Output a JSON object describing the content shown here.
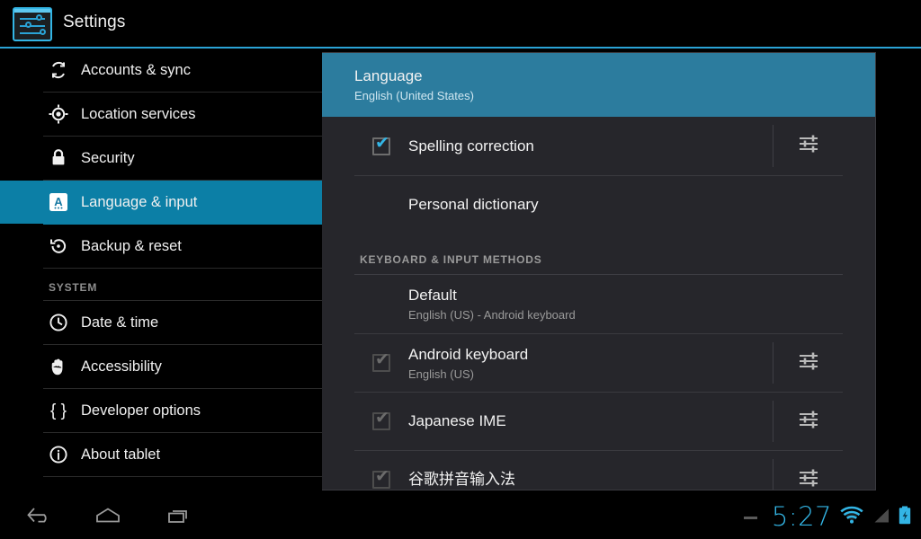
{
  "window": {
    "title": "Settings",
    "app_icon": "settings-sliders-icon"
  },
  "colors": {
    "accent_blue": "#33b5e5",
    "sidebar_selected": "#0c7fa6",
    "row_highlight": "#2c7c9e",
    "panel_bg": "#26262b",
    "sidebar_bg": "#000000"
  },
  "sidebar": {
    "items": [
      {
        "label": "Accounts & sync",
        "icon": "sync-icon",
        "selected": false
      },
      {
        "label": "Location services",
        "icon": "location-icon",
        "selected": false
      },
      {
        "label": "Security",
        "icon": "lock-icon",
        "selected": false
      },
      {
        "label": "Language & input",
        "icon": "language-a-icon",
        "selected": true
      },
      {
        "label": "Backup & reset",
        "icon": "restore-icon",
        "selected": false
      }
    ],
    "section_label": "SYSTEM",
    "system_items": [
      {
        "label": "Date & time",
        "icon": "clock-icon",
        "selected": false
      },
      {
        "label": "Accessibility",
        "icon": "hand-icon",
        "selected": false
      },
      {
        "label": "Developer options",
        "icon": "braces-icon",
        "selected": false
      },
      {
        "label": "About tablet",
        "icon": "info-icon",
        "selected": false
      }
    ]
  },
  "main": {
    "language_row": {
      "title": "Language",
      "subtitle": "English (United States)"
    },
    "spelling_row": {
      "title": "Spelling correction",
      "checked": true,
      "gear": "settings-sliders-icon"
    },
    "dictionary_row": {
      "title": "Personal dictionary"
    },
    "section_header": "KEYBOARD & INPUT METHODS",
    "default_row": {
      "title": "Default",
      "subtitle": "English (US) - Android keyboard"
    },
    "input_methods": [
      {
        "title": "Android keyboard",
        "subtitle": "English (US)",
        "checked": true,
        "disabled": true,
        "gear": "settings-sliders-icon"
      },
      {
        "title": "Japanese IME",
        "subtitle": "",
        "checked": true,
        "disabled": true,
        "gear": "settings-sliders-icon"
      },
      {
        "title": "谷歌拼音输入法",
        "subtitle": "",
        "checked": true,
        "disabled": true,
        "gear": "settings-sliders-icon"
      }
    ],
    "checkmark_glyph": "✔"
  },
  "navbar": {
    "back": "back-icon",
    "home": "home-icon",
    "recents": "recent-apps-icon"
  },
  "status": {
    "clock": "5:27",
    "wifi": "wifi-icon",
    "signal": "cellular-signal-icon",
    "battery": "battery-charging-icon"
  }
}
